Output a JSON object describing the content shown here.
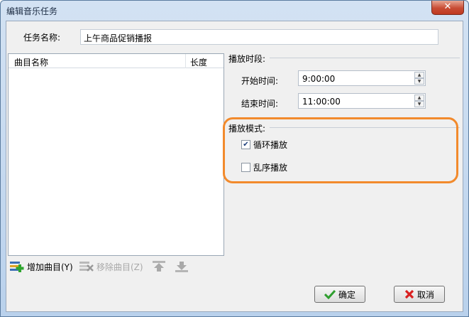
{
  "window": {
    "title": "编辑音乐任务",
    "close_glyph": "✕"
  },
  "task_name": {
    "label": "任务名称:",
    "value": "上午商品促销播报"
  },
  "song_list": {
    "columns": [
      "曲目名称",
      "长度"
    ],
    "rows": []
  },
  "toolbar": {
    "add_label": "增加曲目(Y)",
    "remove_label": "移除曲目(Z)"
  },
  "schedule": {
    "group_title": "播放时段:",
    "start_label": "开始时间:",
    "start_value": "9:00:00",
    "end_label": "结束时间:",
    "end_value": "11:00:00"
  },
  "mode": {
    "group_title": "播放模式:",
    "loop_label": "循环播放",
    "loop_checked": true,
    "shuffle_label": "乱序播放",
    "shuffle_checked": false
  },
  "buttons": {
    "ok_label": "确定",
    "cancel_label": "取消"
  },
  "colors": {
    "highlight": "#f28a2c",
    "ok_icon": "#2e9e2e",
    "cancel_icon": "#d92020"
  }
}
